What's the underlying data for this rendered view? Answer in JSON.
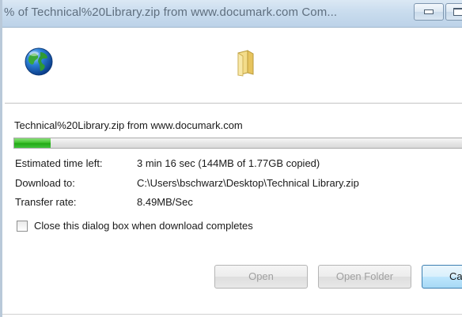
{
  "window": {
    "title": "% of Technical%20Library.zip from www.documark.com Com..."
  },
  "download": {
    "filename_line": "Technical%20Library.zip from www.documark.com",
    "progress_fraction": 0.081,
    "estimated_label": "Estimated time left:",
    "estimated_value": "3 min 16 sec (144MB of 1.77GB copied)",
    "download_to_label": "Download to:",
    "download_to_value": "C:\\Users\\bschwarz\\Desktop\\Technical Library.zip",
    "rate_label": "Transfer rate:",
    "rate_value": "8.49MB/Sec",
    "close_checkbox_label": "Close this dialog box when download completes",
    "close_checkbox_checked": false
  },
  "buttons": {
    "open": "Open",
    "open_folder": "Open Folder",
    "cancel": "Ca"
  },
  "icons": {
    "animation_source": "globe-icon",
    "animation_target": "folder-icon"
  },
  "colors": {
    "progress": "#3fc32e",
    "titlebar": "#c9dcee"
  }
}
